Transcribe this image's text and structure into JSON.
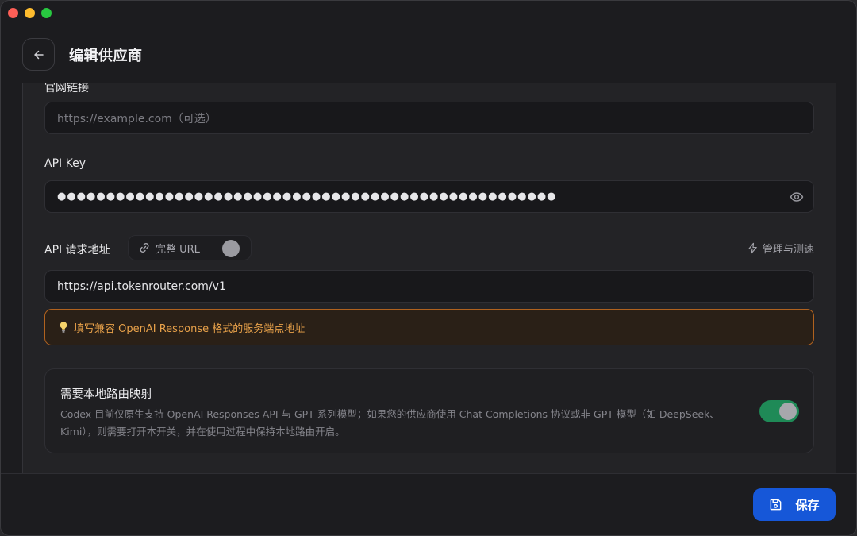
{
  "header": {
    "title": "编辑供应商"
  },
  "fields": {
    "website": {
      "label": "官网链接",
      "placeholder": "https://example.com（可选）"
    },
    "api_key": {
      "label": "API Key",
      "masked_value": "●●●●●●●●●●●●●●●●●●●●●●●●●●●●●●●●●●●●●●●●●●●●●●●●●●●"
    },
    "api_url": {
      "label": "API 请求地址",
      "full_url_toggle_label": "完整 URL",
      "full_url_enabled": false,
      "manage_label": "管理与测速",
      "value": "https://api.tokenrouter.com/v1",
      "hint": "填写兼容 OpenAI Response 格式的服务端点地址"
    }
  },
  "local_mapping": {
    "title": "需要本地路由映射",
    "description": "Codex 目前仅原生支持 OpenAI Responses API 与 GPT 系列模型；如果您的供应商使用 Chat Completions 协议或非 GPT 模型（如 DeepSeek、Kimi），则需要打开本开关，并在使用过程中保持本地路由开启。",
    "enabled": true
  },
  "footer": {
    "save_label": "保存"
  },
  "colors": {
    "accent": "#1657d8",
    "toggle_on": "#1f8a57",
    "hint_border": "#b0621f",
    "hint_text": "#e9a24a"
  },
  "icons": [
    "back-arrow-icon",
    "eye-icon",
    "link-icon",
    "lightning-icon",
    "lightbulb-icon",
    "save-disk-icon"
  ]
}
